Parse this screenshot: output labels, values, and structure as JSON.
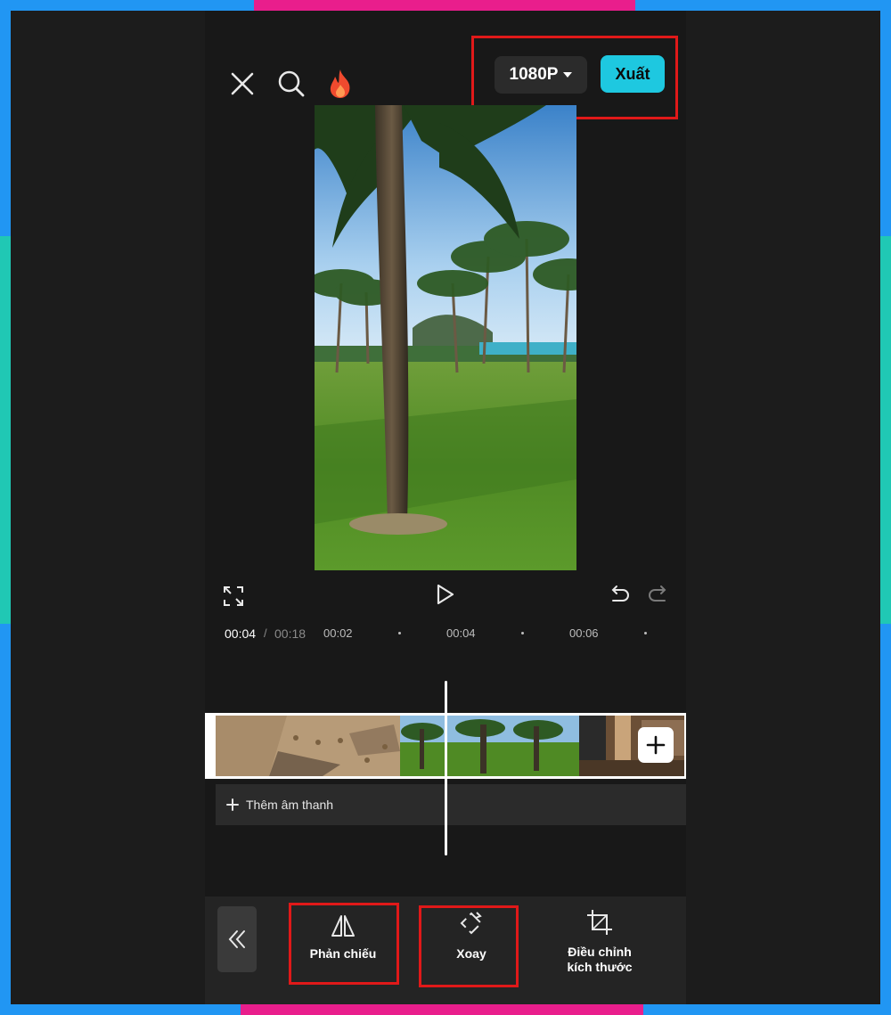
{
  "header": {
    "resolution_label": "1080P",
    "export_label": "Xuất",
    "icons": [
      "close-icon",
      "search-icon",
      "flame-icon"
    ]
  },
  "preview": {
    "image": "palm-tree-lawn-beach-photo"
  },
  "playback": {
    "icons": [
      "fullscreen-icon",
      "play-icon",
      "undo-icon",
      "redo-icon"
    ]
  },
  "timeline": {
    "current_time": "00:04",
    "separator": "/",
    "total_time": "00:18",
    "ruler_ticks": [
      "00:02",
      "00:04",
      "00:06"
    ],
    "clips": [
      "sand-footprints-clip",
      "palm-trees-clip",
      "interior-room-clip"
    ],
    "add_audio_label": "Thêm âm thanh"
  },
  "toolbar": {
    "items": [
      {
        "label": "Phản chiếu",
        "icon": "mirror-icon"
      },
      {
        "label": "Xoay",
        "icon": "rotate-icon"
      },
      {
        "label": "Điều chỉnh\nkích thước",
        "icon": "crop-icon"
      }
    ]
  },
  "colors": {
    "accent": "#1ec8e0",
    "highlight": "#e01919",
    "frame_blue": "#2196f3",
    "frame_teal": "#20c8b4",
    "frame_pink": "#e91e8c"
  }
}
